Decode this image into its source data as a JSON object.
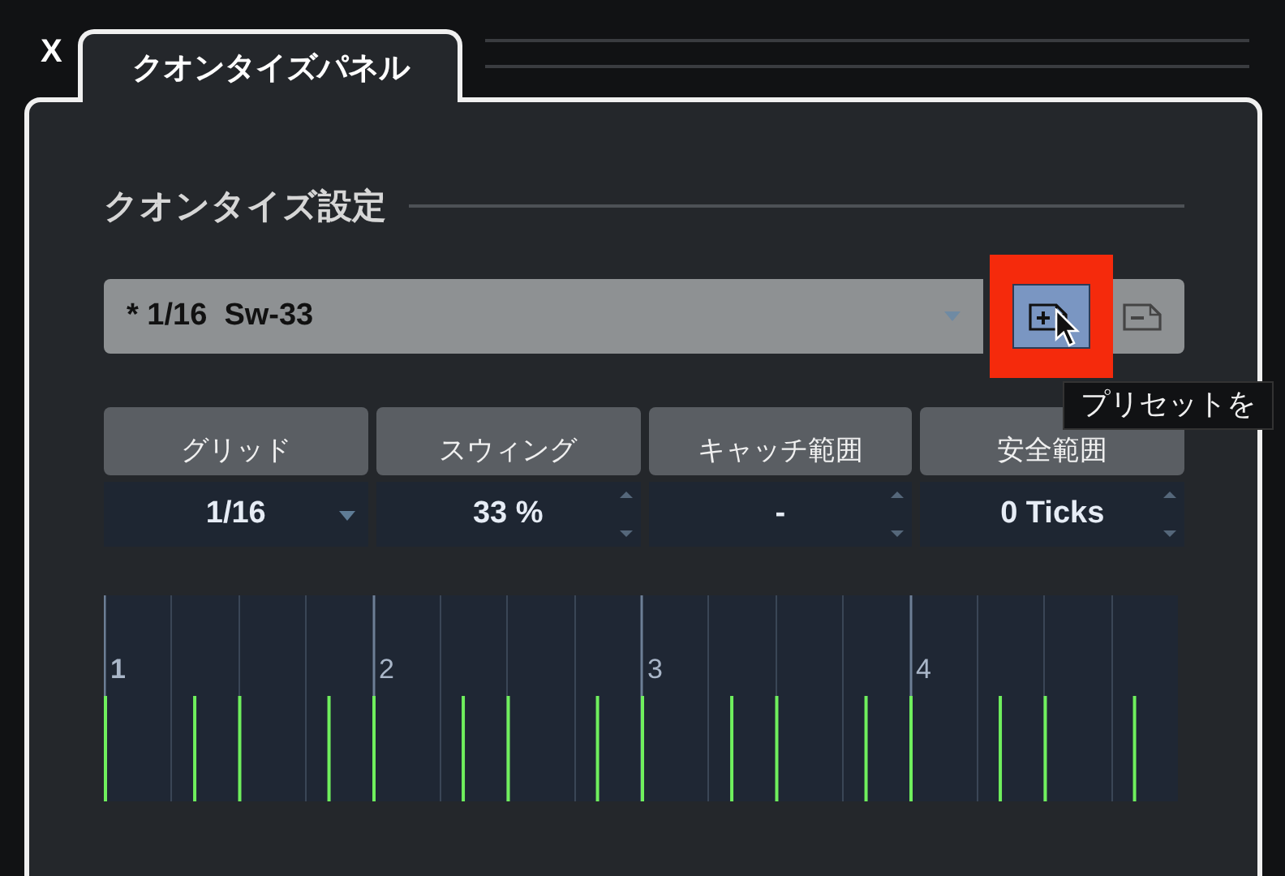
{
  "window": {
    "close_label": "X",
    "tabs": [
      {
        "label": "クオンタイズパネル",
        "selected": true
      }
    ]
  },
  "section": {
    "title": "クオンタイズ設定"
  },
  "preset": {
    "value": "* 1/16  Sw-33",
    "buttons": [
      {
        "kind": "add",
        "highlighted": true
      },
      {
        "kind": "remove",
        "highlighted": false
      }
    ]
  },
  "tooltip": {
    "text": "プリセットを"
  },
  "parameters": [
    {
      "label": "グリッド",
      "value": "1/16",
      "kind": "dropdown"
    },
    {
      "label": "スウィング",
      "value": "33 %",
      "kind": "spinner"
    },
    {
      "label": "キャッチ範囲",
      "value": "-",
      "kind": "spinner"
    },
    {
      "label": "安全範囲",
      "value": "0 Ticks",
      "kind": "spinner"
    }
  ],
  "grid_display": {
    "beats": [
      "1",
      "2",
      "3",
      "4"
    ]
  }
}
